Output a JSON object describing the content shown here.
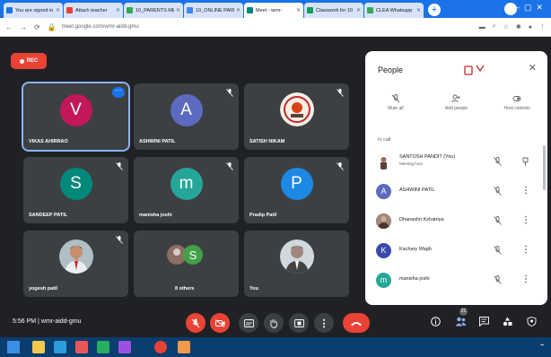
{
  "browser": {
    "tabs": [
      {
        "label": "You are signed in",
        "icon_color": "#1a73e8"
      },
      {
        "label": "Attach teacher",
        "icon_color": "#ea4335"
      },
      {
        "label": "10_PARENTS MEE",
        "icon_color": "#34a853"
      },
      {
        "label": "10_ONLINE PARE",
        "icon_color": "#4285f4"
      },
      {
        "label": "Meet - wmr-",
        "icon_color": "#00897b"
      },
      {
        "label": "Classwork for 10",
        "icon_color": "#0f9d58"
      },
      {
        "label": "CLEA Whatsapp",
        "icon_color": "#34a853"
      }
    ],
    "url": "meet.google.com/wmr-aidd-gmu"
  },
  "meet": {
    "rec_label": "REC",
    "tiles": [
      {
        "name": "VIKAS AHIRRAO",
        "initial": "V",
        "color": "#c2185b",
        "active": true
      },
      {
        "name": "ASHWINI PATIL",
        "initial": "A",
        "color": "#5c6bc0"
      },
      {
        "name": "SATISH NIKAM",
        "initial": "",
        "photo": true
      },
      {
        "name": "SANDEEP PATIL",
        "initial": "S",
        "color": "#00897b"
      },
      {
        "name": "manisha joshi",
        "initial": "m",
        "color": "#26a69a"
      },
      {
        "name": "Pradip Patil",
        "initial": "P",
        "color": "#1e88e5"
      },
      {
        "name": "yogesh patil",
        "initial": "",
        "photo": true
      },
      {
        "name": "8 others",
        "initial": "",
        "group": true
      },
      {
        "name": "You",
        "initial": "",
        "photo": true
      }
    ]
  },
  "people": {
    "title": "People",
    "actions": [
      "Mute all",
      "Add people",
      "Host controls"
    ],
    "in_call": "In call",
    "list": [
      {
        "name": "SANTOSH PANDIT (You)",
        "sub": "Meeting host",
        "photo": true
      },
      {
        "name": "ASHWINI PATIL",
        "initial": "A",
        "color": "#5c6bc0"
      },
      {
        "name": "Dhanashri Kshatriya",
        "photo": true
      },
      {
        "name": "Kachary Wagh",
        "initial": "K",
        "color": "#3949ab"
      },
      {
        "name": "manisha joshi",
        "initial": "m",
        "color": "#26a69a"
      }
    ]
  },
  "bottom": {
    "time_label": "5:56 PM | wmr-aidd-gmu",
    "badge_count": "21"
  }
}
